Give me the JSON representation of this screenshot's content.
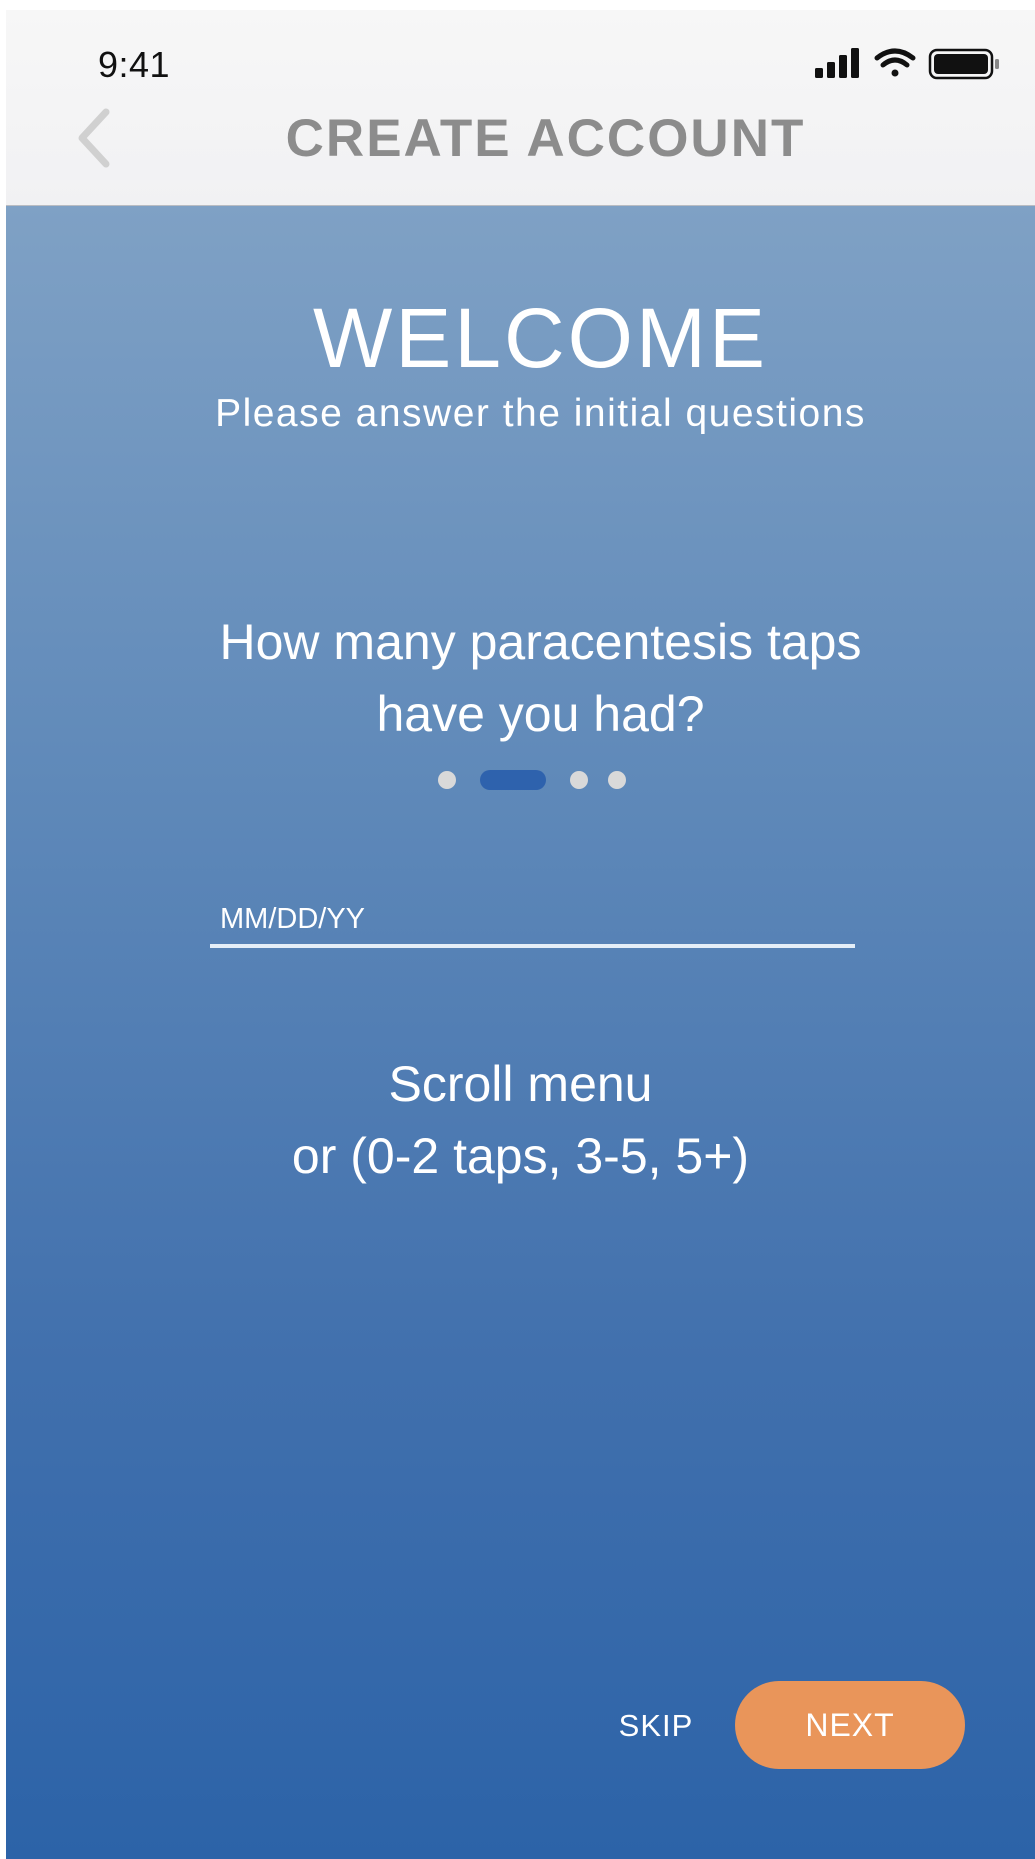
{
  "status_bar": {
    "time": "9:41",
    "icons": [
      "cellular-signal-icon",
      "wifi-icon",
      "battery-icon"
    ]
  },
  "nav": {
    "back_icon": "chevron-left-icon",
    "title": "CREATE ACCOUNT"
  },
  "welcome": {
    "title": "WELCOME",
    "subtitle": "Please answer the initial questions"
  },
  "question": {
    "line1": "How many paracentesis taps",
    "line2": "have you had?"
  },
  "pagination": {
    "total": 4,
    "active_index": 1
  },
  "date_field": {
    "placeholder": "MM/DD/YY",
    "value": ""
  },
  "hint": {
    "line1": "Scroll menu",
    "line2": "or (0-2 taps, 3-5, 5+)"
  },
  "actions": {
    "skip_label": "SKIP",
    "next_label": "NEXT"
  },
  "colors": {
    "nav_title": "#8c8c8c",
    "background_top": "#7fa1c5",
    "background_bottom": "#2c63a8",
    "active_dot": "#2e62ad",
    "inactive_dot": "#d9d9d9",
    "next_button": "#e9955a"
  }
}
